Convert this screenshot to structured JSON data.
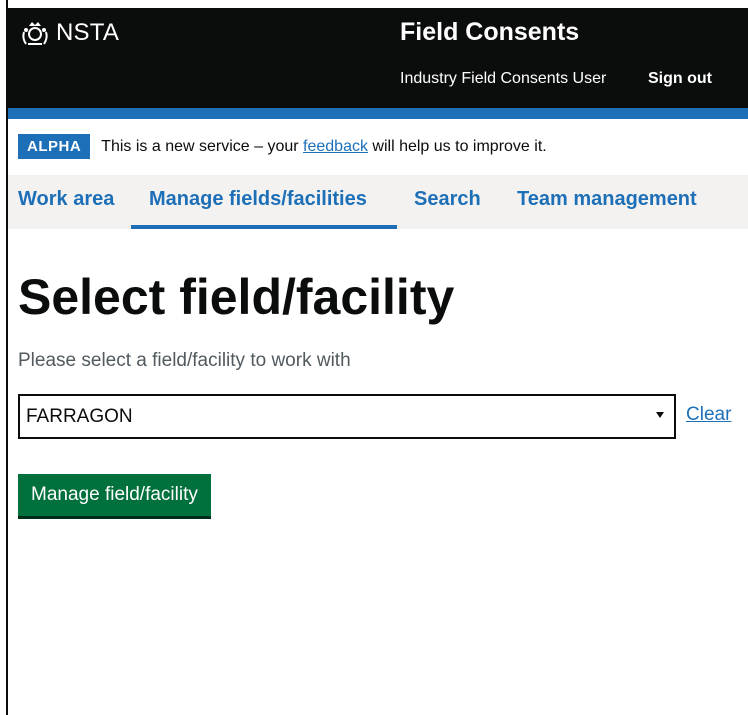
{
  "header": {
    "logo_text": "NSTA",
    "logo_icon": "royal-crest-icon",
    "service_name": "Field Consents",
    "user_name": "Industry Field Consents User",
    "sign_out": "Sign out"
  },
  "phase_banner": {
    "tag": "ALPHA",
    "text_before": "This is a new service – your ",
    "link": "feedback",
    "text_after": " will help us to improve it."
  },
  "nav": {
    "items": [
      "Work area",
      "Manage fields/facilities",
      "Search",
      "Team management"
    ],
    "active_index": 1
  },
  "main": {
    "title": "Select field/facility",
    "hint": "Please select a field/facility to work with",
    "select_value": "FARRAGON",
    "clear_link": "Clear",
    "submit_label": "Manage field/facility"
  },
  "colors": {
    "header_bg": "#0b0c0c",
    "brand_blue": "#1d70b8",
    "button_green": "#00703c",
    "nav_bg": "#f3f2f1"
  }
}
